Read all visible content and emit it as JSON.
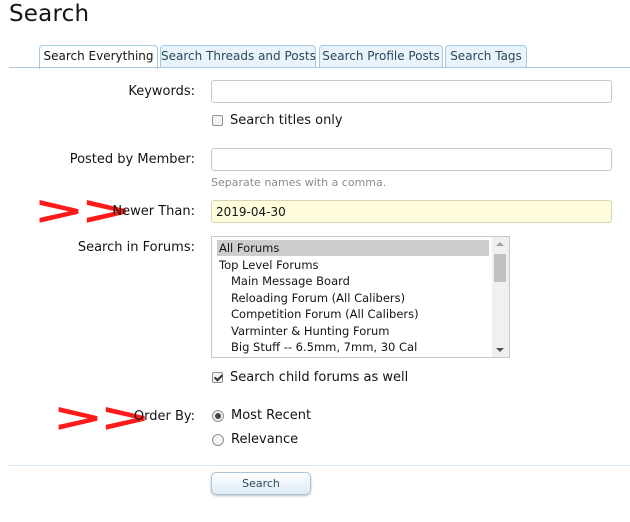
{
  "page": {
    "title": "Search"
  },
  "tabs": [
    {
      "label": "Search Everything",
      "active": true
    },
    {
      "label": "Search Threads and Posts",
      "active": false
    },
    {
      "label": "Search Profile Posts",
      "active": false
    },
    {
      "label": "Search Tags",
      "active": false
    }
  ],
  "form": {
    "keywords": {
      "label": "Keywords:",
      "value": ""
    },
    "titles_only": {
      "label": "Search titles only",
      "checked": false
    },
    "posted_by": {
      "label": "Posted by Member:",
      "value": "",
      "hint": "Separate names with a comma."
    },
    "newer_than": {
      "label": "Newer Than:",
      "value": "2019-04-30"
    },
    "forums": {
      "label": "Search in Forums:",
      "items": [
        {
          "label": "All Forums",
          "selected": true,
          "indent": false
        },
        {
          "label": "Top Level Forums",
          "selected": false,
          "indent": false
        },
        {
          "label": "Main Message Board",
          "selected": false,
          "indent": true
        },
        {
          "label": "Reloading Forum (All Calibers)",
          "selected": false,
          "indent": true
        },
        {
          "label": "Competition Forum (All Calibers)",
          "selected": false,
          "indent": true
        },
        {
          "label": "Varminter & Hunting Forum",
          "selected": false,
          "indent": true
        },
        {
          "label": "Big Stuff -- 6.5mm, 7mm, 30 Cal",
          "selected": false,
          "indent": true
        }
      ]
    },
    "child_forums": {
      "label": "Search child forums as well",
      "checked": true
    },
    "order_by": {
      "label": "Order By:",
      "options": [
        {
          "label": "Most Recent",
          "selected": true
        },
        {
          "label": "Relevance",
          "selected": false
        }
      ]
    },
    "submit_label": "Search"
  },
  "annotations": {
    "arrow_text": ">>",
    "color": "#ff1a1a"
  }
}
